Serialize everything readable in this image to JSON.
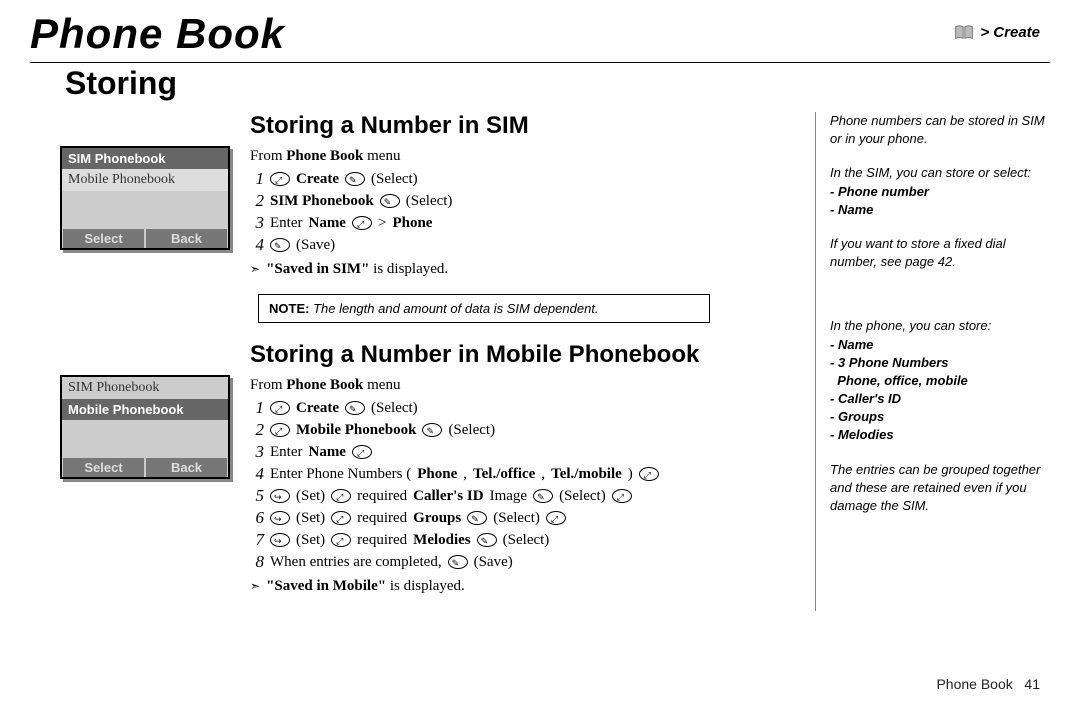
{
  "header": {
    "main_title": "Phone Book",
    "breadcrumb": "> Create",
    "storing_title": "Storing"
  },
  "sim_section": {
    "title": "Storing a Number in SIM",
    "from_line_pre": "From ",
    "from_line_bold": "Phone Book",
    "from_line_post": " menu",
    "screen": {
      "selected": "SIM Phonebook",
      "other": "Mobile Phonebook",
      "btn_left": "Select",
      "btn_right": "Back"
    },
    "steps": {
      "s1_num": "1",
      "s1_bold": "Create",
      "s1_action": "(Select)",
      "s2_num": "2",
      "s2_bold": "SIM Phonebook",
      "s2_action": "(Select)",
      "s3_num": "3",
      "s3_pre": "Enter ",
      "s3_bold": "Name",
      "s3_mid": " > ",
      "s3_bold2": "Phone",
      "s4_num": "4",
      "s4_action": "(Save)"
    },
    "result_bold": "\"Saved in SIM\"",
    "result_post": " is displayed.",
    "note_label": "NOTE:",
    "note_text": " The length and amount of data is SIM dependent."
  },
  "mobile_section": {
    "title": "Storing a Number in Mobile Phonebook",
    "from_line_pre": "From ",
    "from_line_bold": "Phone Book",
    "from_line_post": " menu",
    "screen": {
      "other": "SIM Phonebook",
      "selected": "Mobile Phonebook",
      "btn_left": "Select",
      "btn_right": "Back"
    },
    "steps": {
      "s1_num": "1",
      "s1_bold": "Create",
      "s1_action": "(Select)",
      "s2_num": "2",
      "s2_bold": "Mobile Phonebook",
      "s2_action": "(Select)",
      "s3_num": "3",
      "s3_pre": "Enter ",
      "s3_bold": "Name",
      "s4_num": "4",
      "s4_pre": "Enter Phone Numbers (",
      "s4_bold": "Phone",
      "s4_mid1": ", ",
      "s4_bold2": "Tel./office",
      "s4_mid2": ", ",
      "s4_bold3": "Tel./mobile",
      "s4_post": ") ",
      "s5_num": "5",
      "s5_pre": "(Set) ",
      "s5_mid": " required ",
      "s5_bold": "Caller's ID",
      "s5_post": " Image ",
      "s5_action": "(Select) ",
      "s6_num": "6",
      "s6_pre": "(Set) ",
      "s6_mid": " required ",
      "s6_bold": "Groups",
      "s6_action": " (Select) ",
      "s7_num": "7",
      "s7_pre": "(Set) ",
      "s7_mid": " required ",
      "s7_bold": "Melodies",
      "s7_action": " (Select)",
      "s8_num": "8",
      "s8_pre": "When entries are completed, ",
      "s8_action": "(Save)"
    },
    "result_bold": "\"Saved in Mobile\"",
    "result_post": " is displayed."
  },
  "sidebar": {
    "p1": "Phone numbers can be stored in SIM or in your phone.",
    "p2": "In the SIM, you can store or select:",
    "i1": "- Phone number",
    "i2": "- Name",
    "p3": "If you want to store a fixed dial number, see page 42.",
    "p4": "In the phone, you can store:",
    "j1": "- Name",
    "j2a": "- 3 Phone Numbers",
    "j2b": "Phone, office, mobile",
    "j3": "- Caller's ID",
    "j4": "- Groups",
    "j5": "- Melodies",
    "p5": "The entries can be grouped together and these are retained even if you damage the SIM."
  },
  "footer": {
    "label": "Phone Book",
    "page": "41"
  }
}
